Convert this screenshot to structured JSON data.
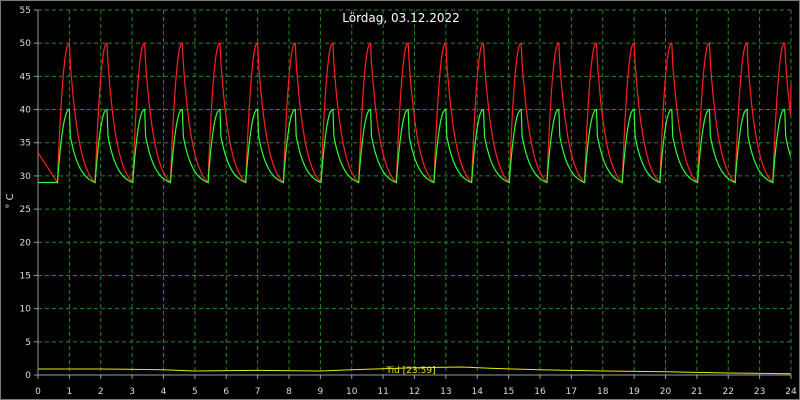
{
  "colors": {
    "background": "#000000",
    "grid": "#1e8a1e",
    "axis": "#9a9a9a",
    "red": "#ff2020",
    "green": "#30ff30",
    "yellow": "#e8e800"
  },
  "chart_data": {
    "type": "line",
    "title": "Lördag, 03.12.2022",
    "ylabel": "° C",
    "xlabel": "",
    "xlim": [
      0,
      24
    ],
    "ylim": [
      0,
      55
    ],
    "x_ticks": [
      0,
      1,
      2,
      3,
      4,
      5,
      6,
      7,
      8,
      9,
      10,
      11,
      12,
      13,
      14,
      15,
      16,
      17,
      18,
      19,
      20,
      21,
      22,
      23,
      24
    ],
    "y_ticks": [
      0,
      5,
      10,
      15,
      20,
      25,
      30,
      35,
      40,
      45,
      50,
      55
    ],
    "grid": true,
    "annotation": {
      "text": "Tid [23:59]",
      "x": 12,
      "y": 0.2
    },
    "cycle_peaks_hours": [
      1.0,
      2.2,
      3.4,
      4.6,
      5.8,
      7.0,
      8.2,
      9.4,
      10.6,
      11.8,
      13.0,
      14.2,
      15.4,
      16.6,
      17.8,
      19.0,
      20.2,
      21.4,
      22.6,
      23.8
    ],
    "series": [
      {
        "color": "red",
        "profile": "sawtooth cycle: rise from ~29 to ~50, drop to ~47, exponential decay to ~29",
        "min": 29,
        "max": 50,
        "start_value": 33.5,
        "end_value": 44
      },
      {
        "color": "green",
        "profile": "sawtooth cycle: rise from ~29 to ~40, drop to ~36, exponential decay to ~29",
        "min": 29,
        "max": 40
      },
      {
        "color": "yellow",
        "profile": "nearly flat near zero",
        "points": [
          [
            0,
            0.9
          ],
          [
            2,
            0.9
          ],
          [
            4,
            0.8
          ],
          [
            5,
            0.6
          ],
          [
            7,
            0.7
          ],
          [
            9,
            0.6
          ],
          [
            10,
            0.8
          ],
          [
            12,
            1.1
          ],
          [
            13.5,
            1.2
          ],
          [
            14.5,
            1.0
          ],
          [
            16,
            0.8
          ],
          [
            18,
            0.6
          ],
          [
            20,
            0.5
          ],
          [
            22,
            0.3
          ],
          [
            24,
            0.2
          ]
        ]
      }
    ]
  }
}
